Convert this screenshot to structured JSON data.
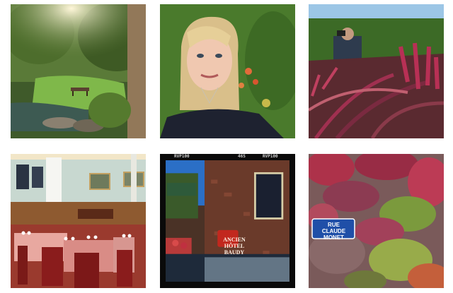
{
  "photos": [
    {
      "id": "garden",
      "icon": "garden-photo",
      "alt": "garden pond and lawn"
    },
    {
      "id": "selfie",
      "icon": "portrait-photo",
      "alt": "blonde woman selfie"
    },
    {
      "id": "photographer",
      "icon": "photographer-photo",
      "alt": "photographer among red plants"
    },
    {
      "id": "restaurant",
      "icon": "dining-room-photo",
      "alt": "dining room with red chairs"
    },
    {
      "id": "hotel",
      "icon": "hotel-facade-photo",
      "alt": "brick hotel facade",
      "film_left": "RVP100",
      "film_mid": "46S",
      "film_right": "RVP100",
      "sign_line1": "ANCIEN",
      "sign_line2": "HÔTEL BAUDY"
    },
    {
      "id": "street-sign",
      "icon": "ivy-wall-photo",
      "alt": "ivy wall with street sign",
      "sign_line1": "RUE",
      "sign_line2": "CLAUDE MONET"
    }
  ],
  "colors": {
    "ivy_red": "#b0304a",
    "ivy_green": "#7c9e3c",
    "sign_blue": "#1f4fa8",
    "chair_red": "#8a1c1c"
  }
}
